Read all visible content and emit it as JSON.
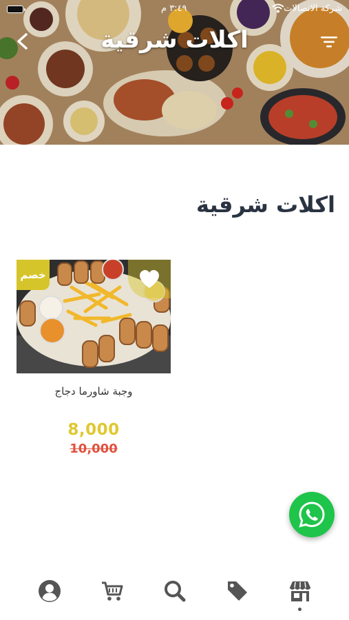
{
  "status_bar": {
    "carrier": "شركة الاتصالات",
    "time": "٣:٤٩ م"
  },
  "header": {
    "title": "اكلات شرقية",
    "back_icon": "chevron-left-icon",
    "filter_icon": "filter-icon"
  },
  "page": {
    "title": "اكلات شرقية"
  },
  "products": [
    {
      "name": "وجبة شاورما دجاج",
      "badge": "خصم",
      "price": "8,000",
      "old_price": "10,000",
      "favorite_icon": "heart-icon"
    }
  ],
  "fab": {
    "icon": "whatsapp-icon"
  },
  "bottom_nav": {
    "items": [
      {
        "icon": "profile-icon"
      },
      {
        "icon": "cart-icon"
      },
      {
        "icon": "search-icon"
      },
      {
        "icon": "tag-icon"
      },
      {
        "icon": "store-icon",
        "active": true
      }
    ]
  },
  "colors": {
    "accent_yellow": "#e0c831",
    "old_price_red": "#e0513e",
    "title_dark": "#2a3342",
    "whatsapp_green": "#1fc44a"
  }
}
